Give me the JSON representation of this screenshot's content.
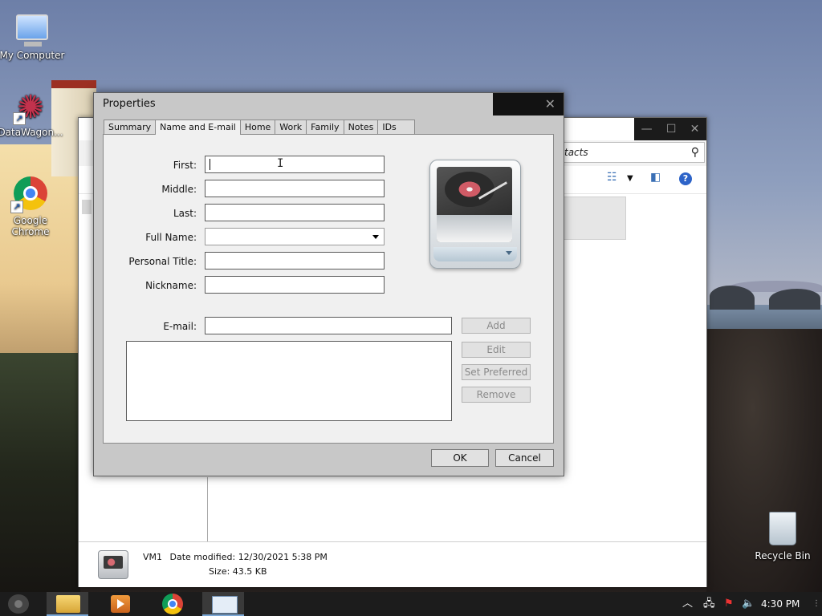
{
  "desktop": {
    "icons": [
      {
        "label": "My Computer"
      },
      {
        "label": "DataWagon..."
      },
      {
        "label": "Google Chrome"
      },
      {
        "label": "Recycle Bin"
      }
    ]
  },
  "explorer": {
    "search_text": "tacts",
    "details": {
      "name": "VM1",
      "date_label": "Date modified:",
      "date_value": "12/30/2021 5:38 PM",
      "size_label": "Size:",
      "size_value": "43.5 KB"
    }
  },
  "dialog": {
    "title": "Properties",
    "tabs": [
      {
        "label": "Summary",
        "active": false
      },
      {
        "label": "Name and E-mail",
        "active": true
      },
      {
        "label": "Home",
        "active": false
      },
      {
        "label": "Work",
        "active": false
      },
      {
        "label": "Family",
        "active": false
      },
      {
        "label": "Notes",
        "active": false
      },
      {
        "label": "IDs",
        "active": false
      }
    ],
    "fields": {
      "first": {
        "label": "First:",
        "value": ""
      },
      "middle": {
        "label": "Middle:",
        "value": ""
      },
      "last": {
        "label": "Last:",
        "value": ""
      },
      "full_name": {
        "label": "Full Name:",
        "value": ""
      },
      "personal_title": {
        "label": "Personal Title:",
        "value": ""
      },
      "nickname": {
        "label": "Nickname:",
        "value": ""
      },
      "email": {
        "label": "E-mail:",
        "value": ""
      }
    },
    "buttons": {
      "add": "Add",
      "edit": "Edit",
      "set_preferred": "Set Preferred",
      "remove": "Remove",
      "ok": "OK",
      "cancel": "Cancel"
    }
  },
  "taskbar": {
    "clock": "4:30 PM"
  },
  "colors": {
    "taskbar": "#1c1c1c",
    "dialog_bg": "#c8c8c8",
    "panel_bg": "#f0f0f0",
    "title_bar_dark": "#121212"
  }
}
